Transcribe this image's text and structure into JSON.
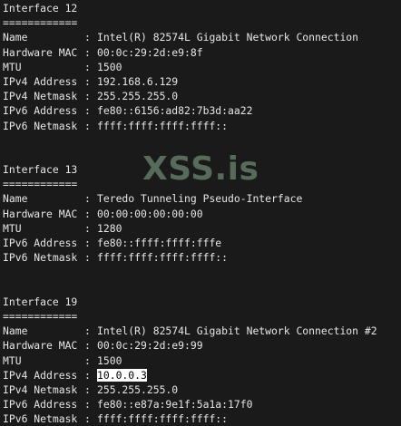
{
  "watermark": "XSS.is",
  "interfaces": [
    {
      "header": "Interface 12",
      "underline": "============",
      "rows": [
        {
          "key": "Name",
          "sep": ":",
          "value": "Intel(R) 82574L Gigabit Network Connection"
        },
        {
          "key": "Hardware MAC",
          "sep": ":",
          "value": "00:0c:29:2d:e9:8f"
        },
        {
          "key": "MTU",
          "sep": ":",
          "value": "1500"
        },
        {
          "key": "IPv4 Address",
          "sep": ":",
          "value": "192.168.6.129"
        },
        {
          "key": "IPv4 Netmask",
          "sep": ":",
          "value": "255.255.255.0"
        },
        {
          "key": "IPv6 Address",
          "sep": ":",
          "value": "fe80::6156:ad82:7b3d:aa22"
        },
        {
          "key": "IPv6 Netmask",
          "sep": ":",
          "value": "ffff:ffff:ffff:ffff::"
        }
      ]
    },
    {
      "header": "Interface 13",
      "underline": "============",
      "rows": [
        {
          "key": "Name",
          "sep": ":",
          "value": "Teredo Tunneling Pseudo-Interface"
        },
        {
          "key": "Hardware MAC",
          "sep": ":",
          "value": "00:00:00:00:00:00"
        },
        {
          "key": "MTU",
          "sep": ":",
          "value": "1280"
        },
        {
          "key": "IPv6 Address",
          "sep": ":",
          "value": "fe80::ffff:ffff:fffe"
        },
        {
          "key": "IPv6 Netmask",
          "sep": ":",
          "value": "ffff:ffff:ffff:ffff::"
        }
      ]
    },
    {
      "header": "Interface 19",
      "underline": "============",
      "rows": [
        {
          "key": "Name",
          "sep": ":",
          "value": "Intel(R) 82574L Gigabit Network Connection #2"
        },
        {
          "key": "Hardware MAC",
          "sep": ":",
          "value": "00:0c:29:2d:e9:99"
        },
        {
          "key": "MTU",
          "sep": ":",
          "value": "1500"
        },
        {
          "key": "IPv4 Address",
          "sep": ":",
          "value": "10.0.0.3",
          "highlighted": true
        },
        {
          "key": "IPv4 Netmask",
          "sep": ":",
          "value": "255.255.255.0"
        },
        {
          "key": "IPv6 Address",
          "sep": ":",
          "value": "fe80::e87a:9e1f:5a1a:17f0"
        },
        {
          "key": "IPv6 Netmask",
          "sep": ":",
          "value": "ffff:ffff:ffff:ffff::"
        }
      ]
    }
  ]
}
